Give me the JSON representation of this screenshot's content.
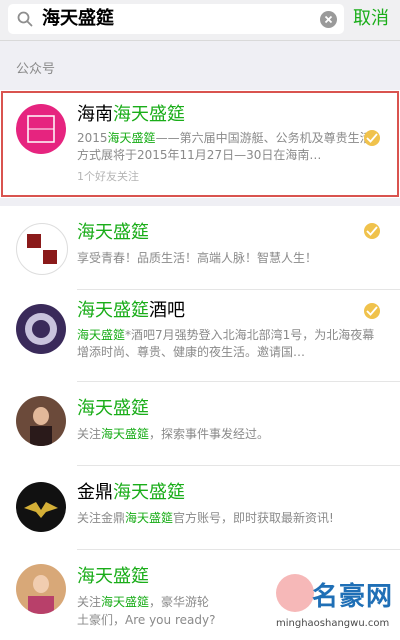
{
  "search": {
    "query": "海天盛筵",
    "cancel_label": "取消"
  },
  "section": {
    "label": "公众号"
  },
  "results": [
    {
      "name_prefix": "海南",
      "name_hl": "海天盛筵",
      "name_suffix": "",
      "desc_prefix": "2015",
      "desc_hl": "海天盛筵",
      "desc_suffix": "——第六届中国游艇、公务机及尊贵生活方式展将于2015年11月27日—30日在海南…",
      "friends": "1个好友关注",
      "verified": true,
      "avatar_color": "#e6247f"
    },
    {
      "name_prefix": "",
      "name_hl": "海天盛筵",
      "name_suffix": "",
      "desc_prefix": "享受青春！品质生活！高端人脉！智慧人生！",
      "desc_hl": "",
      "desc_suffix": "",
      "friends": "",
      "verified": true,
      "avatar_color": "#ffffff"
    },
    {
      "name_prefix": "",
      "name_hl": "海天盛筵",
      "name_suffix": "酒吧",
      "desc_prefix": "",
      "desc_hl": "海天盛筵",
      "desc_suffix": "*酒吧7月强势登入北海北部湾1号，为北海夜幕增添时尚、尊贵、健康的夜生活。邀请国…",
      "friends": "",
      "verified": true,
      "avatar_color": "#3a2a5a"
    },
    {
      "name_prefix": "",
      "name_hl": "海天盛筵",
      "name_suffix": "",
      "desc_prefix": "关注",
      "desc_hl": "海天盛筵",
      "desc_suffix": "，探索事件事发经过。",
      "friends": "",
      "verified": false,
      "avatar_color": "#6b4a3a"
    },
    {
      "name_prefix": "金鼎",
      "name_hl": "海天盛筵",
      "name_suffix": "",
      "desc_prefix": "关注金鼎",
      "desc_hl": "海天盛筵",
      "desc_suffix": "官方账号，即时获取最新资讯!",
      "friends": "",
      "verified": false,
      "avatar_color": "#111111"
    },
    {
      "name_prefix": "",
      "name_hl": "海天盛筵",
      "name_suffix": "",
      "desc_prefix": "关注",
      "desc_hl": "海天盛筵",
      "desc_suffix": "，豪华游轮",
      "desc2": "土豪们，Are you ready?",
      "friends": "",
      "verified": false,
      "avatar_color": "#d8a878"
    }
  ],
  "watermark": {
    "name": "名豪网",
    "url": "minghaoshangwu.com"
  },
  "colors": {
    "accent": "#1aad19",
    "highlight_border": "#d9534f",
    "verified": "#f0c24c"
  }
}
